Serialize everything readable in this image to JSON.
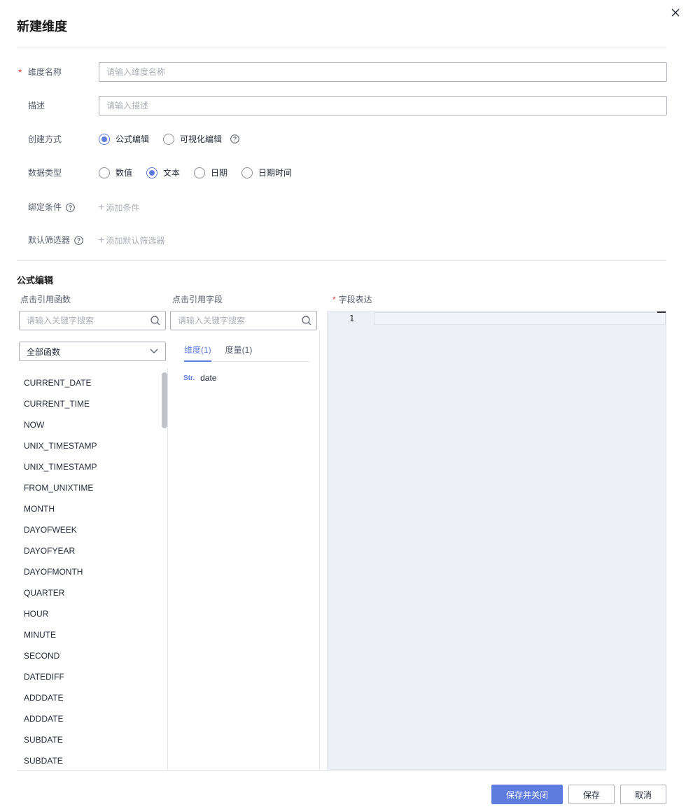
{
  "dialog": {
    "title": "新建维度",
    "close_icon": "close-icon"
  },
  "form": {
    "name": {
      "label": "维度名称",
      "required": true,
      "placeholder": "请输入维度名称",
      "value": ""
    },
    "description": {
      "label": "描述",
      "placeholder": "请输入描述",
      "value": ""
    },
    "creation_mode": {
      "label": "创建方式",
      "options": [
        {
          "label": "公式编辑",
          "checked": true
        },
        {
          "label": "可视化编辑",
          "checked": false
        }
      ],
      "help_icon": "question-circle-icon"
    },
    "data_type": {
      "label": "数据类型",
      "options": [
        {
          "label": "数值",
          "checked": false
        },
        {
          "label": "文本",
          "checked": true
        },
        {
          "label": "日期",
          "checked": false
        },
        {
          "label": "日期时间",
          "checked": false
        }
      ]
    },
    "bind_condition": {
      "label": "绑定条件",
      "add_label": "添加条件",
      "help_icon": "question-circle-icon"
    },
    "default_filter": {
      "label": "默认筛选器",
      "add_label": "添加默认筛选器",
      "help_icon": "question-circle-icon"
    }
  },
  "formula": {
    "section_title": "公式编辑",
    "functions": {
      "label": "点击引用函数",
      "search_placeholder": "请输入关键字搜索",
      "category_selected": "全部函数",
      "items": [
        "CURRENT_DATE",
        "CURRENT_TIME",
        "NOW",
        "UNIX_TIMESTAMP",
        "UNIX_TIMESTAMP",
        "FROM_UNIXTIME",
        "MONTH",
        "DAYOFWEEK",
        "DAYOFYEAR",
        "DAYOFMONTH",
        "QUARTER",
        "HOUR",
        "MINUTE",
        "SECOND",
        "DATEDIFF",
        "ADDDATE",
        "ADDDATE",
        "SUBDATE",
        "SUBDATE"
      ]
    },
    "fields": {
      "label": "点击引用字段",
      "search_placeholder": "请输入关键字搜索",
      "tabs": [
        {
          "label": "维度(1)",
          "active": true
        },
        {
          "label": "度量(1)",
          "active": false
        }
      ],
      "items": [
        {
          "type": "Str.",
          "name": "date"
        }
      ]
    },
    "expression": {
      "label": "字段表达",
      "required": true,
      "line_number": "1",
      "content": ""
    }
  },
  "footer": {
    "save_close_label": "保存并关闭",
    "save_label": "保存",
    "cancel_label": "取消"
  },
  "colors": {
    "primary": "#5e7ce0",
    "required": "#e54545",
    "editor_bg": "#eef0f8"
  }
}
